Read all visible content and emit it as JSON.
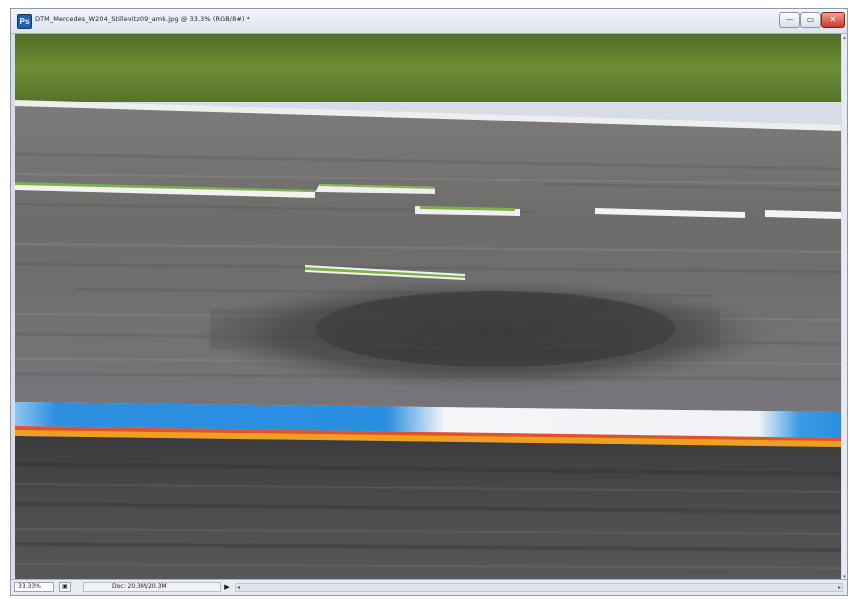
{
  "window": {
    "title": "DTM_Mercedes_W204_Stillevitz09_amk.jpg @ 33.3% (RGB/8#) *",
    "app_icon_glyph": "Ps",
    "controls": {
      "minimize": "—",
      "maximize": "▭",
      "close": "✕"
    }
  },
  "statusbar": {
    "zoom": "33.33%",
    "doc_info": "Doc: 20.3M/20.3M",
    "nav_arrow": "▶",
    "scroll_left": "◂",
    "scroll_right": "▸"
  },
  "vscroll": {
    "up": "▴",
    "down": "▾"
  },
  "image": {
    "description_colors": {
      "grass": "#5a7a2c",
      "asphalt": "#6e6e6e",
      "kerb_blue": "#2a8ee0",
      "kerb_orange": "#f08a1e",
      "lane_white": "#f2f2f2",
      "lane_green": "#7fb04a"
    }
  }
}
